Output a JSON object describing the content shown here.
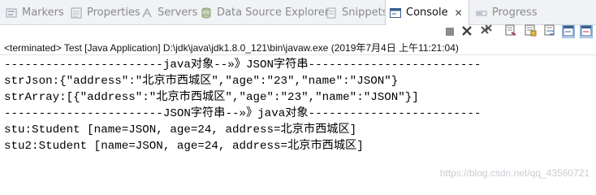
{
  "tabs": [
    {
      "label": "Markers",
      "icon": "markers-icon",
      "active": false
    },
    {
      "label": "Properties",
      "icon": "properties-icon",
      "active": false
    },
    {
      "label": "Servers",
      "icon": "servers-icon",
      "active": false
    },
    {
      "label": "Data Source Explorer",
      "icon": "data-source-icon",
      "active": false
    },
    {
      "label": "Snippets",
      "icon": "snippets-icon",
      "active": false
    },
    {
      "label": "Console",
      "icon": "console-icon",
      "active": true
    },
    {
      "label": "Progress",
      "icon": "progress-icon",
      "active": false
    }
  ],
  "tab_close": "✕",
  "status": "<terminated> Test [Java Application] D:\\jdk\\java\\jdk1.8.0_121\\bin\\javaw.exe (2019年7月4日 上午11:21:04)",
  "console_lines": [
    "-----------------------java对象--»》JSON字符串-------------------------",
    "strJson:{\"address\":\"北京市西城区\",\"age\":\"23\",\"name\":\"JSON\"}",
    "strArray:[{\"address\":\"北京市西城区\",\"age\":\"23\",\"name\":\"JSON\"}]",
    "-----------------------JSON字符串--»》java对象-------------------------",
    "stu:Student [name=JSON, age=24, address=北京市西城区]",
    "stu2:Student [name=JSON, age=24, address=北京市西城区]"
  ],
  "watermark": "https://blog.csdn.net/qq_43560721",
  "colors": {
    "tabbar_bg": "#f0f2f5",
    "active_tab_bg": "#ffffff",
    "inactive_text": "#8a8a8a",
    "console_text": "#000000"
  }
}
